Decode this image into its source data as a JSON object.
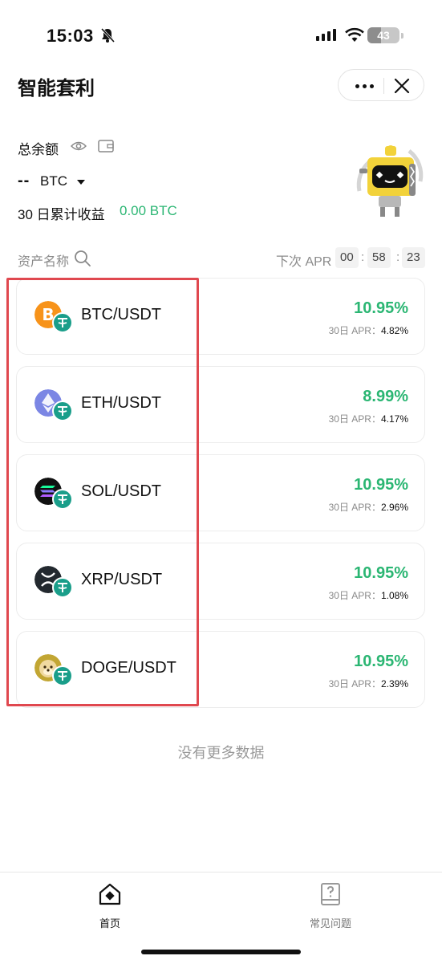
{
  "status_bar": {
    "time": "15:03",
    "battery": "43"
  },
  "header": {
    "title": "智能套利"
  },
  "balance": {
    "label": "总余额",
    "amount": "--",
    "currency": "BTC",
    "profit_label": "30 日累计收益",
    "profit_value": "0.00 BTC"
  },
  "list_header": {
    "name_label": "资产名称",
    "next_apr_label": "下次 APR",
    "countdown": [
      "00",
      "58",
      "23"
    ]
  },
  "pairs": [
    {
      "name": "BTC/USDT",
      "apr": "10.95%",
      "apr30_label": "30日 APR：",
      "apr30": "4.82%",
      "icon": "bitcoin-icon",
      "color": "#f7931a"
    },
    {
      "name": "ETH/USDT",
      "apr": "8.99%",
      "apr30_label": "30日 APR：",
      "apr30": "4.17%",
      "icon": "ethereum-icon",
      "color": "#7b86e4"
    },
    {
      "name": "SOL/USDT",
      "apr": "10.95%",
      "apr30_label": "30日 APR：",
      "apr30": "2.96%",
      "icon": "solana-icon",
      "color": "#111111"
    },
    {
      "name": "XRP/USDT",
      "apr": "10.95%",
      "apr30_label": "30日 APR：",
      "apr30": "1.08%",
      "icon": "xrp-icon",
      "color": "#23292f"
    },
    {
      "name": "DOGE/USDT",
      "apr": "10.95%",
      "apr30_label": "30日 APR：",
      "apr30": "2.39%",
      "icon": "doge-icon",
      "color": "#c2a633"
    }
  ],
  "footer_text": "没有更多数据",
  "tabs": [
    {
      "label": "首页",
      "icon": "home-icon",
      "active": true
    },
    {
      "label": "常见问题",
      "icon": "faq-icon",
      "active": false
    }
  ],
  "colors": {
    "positive": "#2bb673",
    "highlight": "#e0484f",
    "tether": "#1a9e8a"
  }
}
